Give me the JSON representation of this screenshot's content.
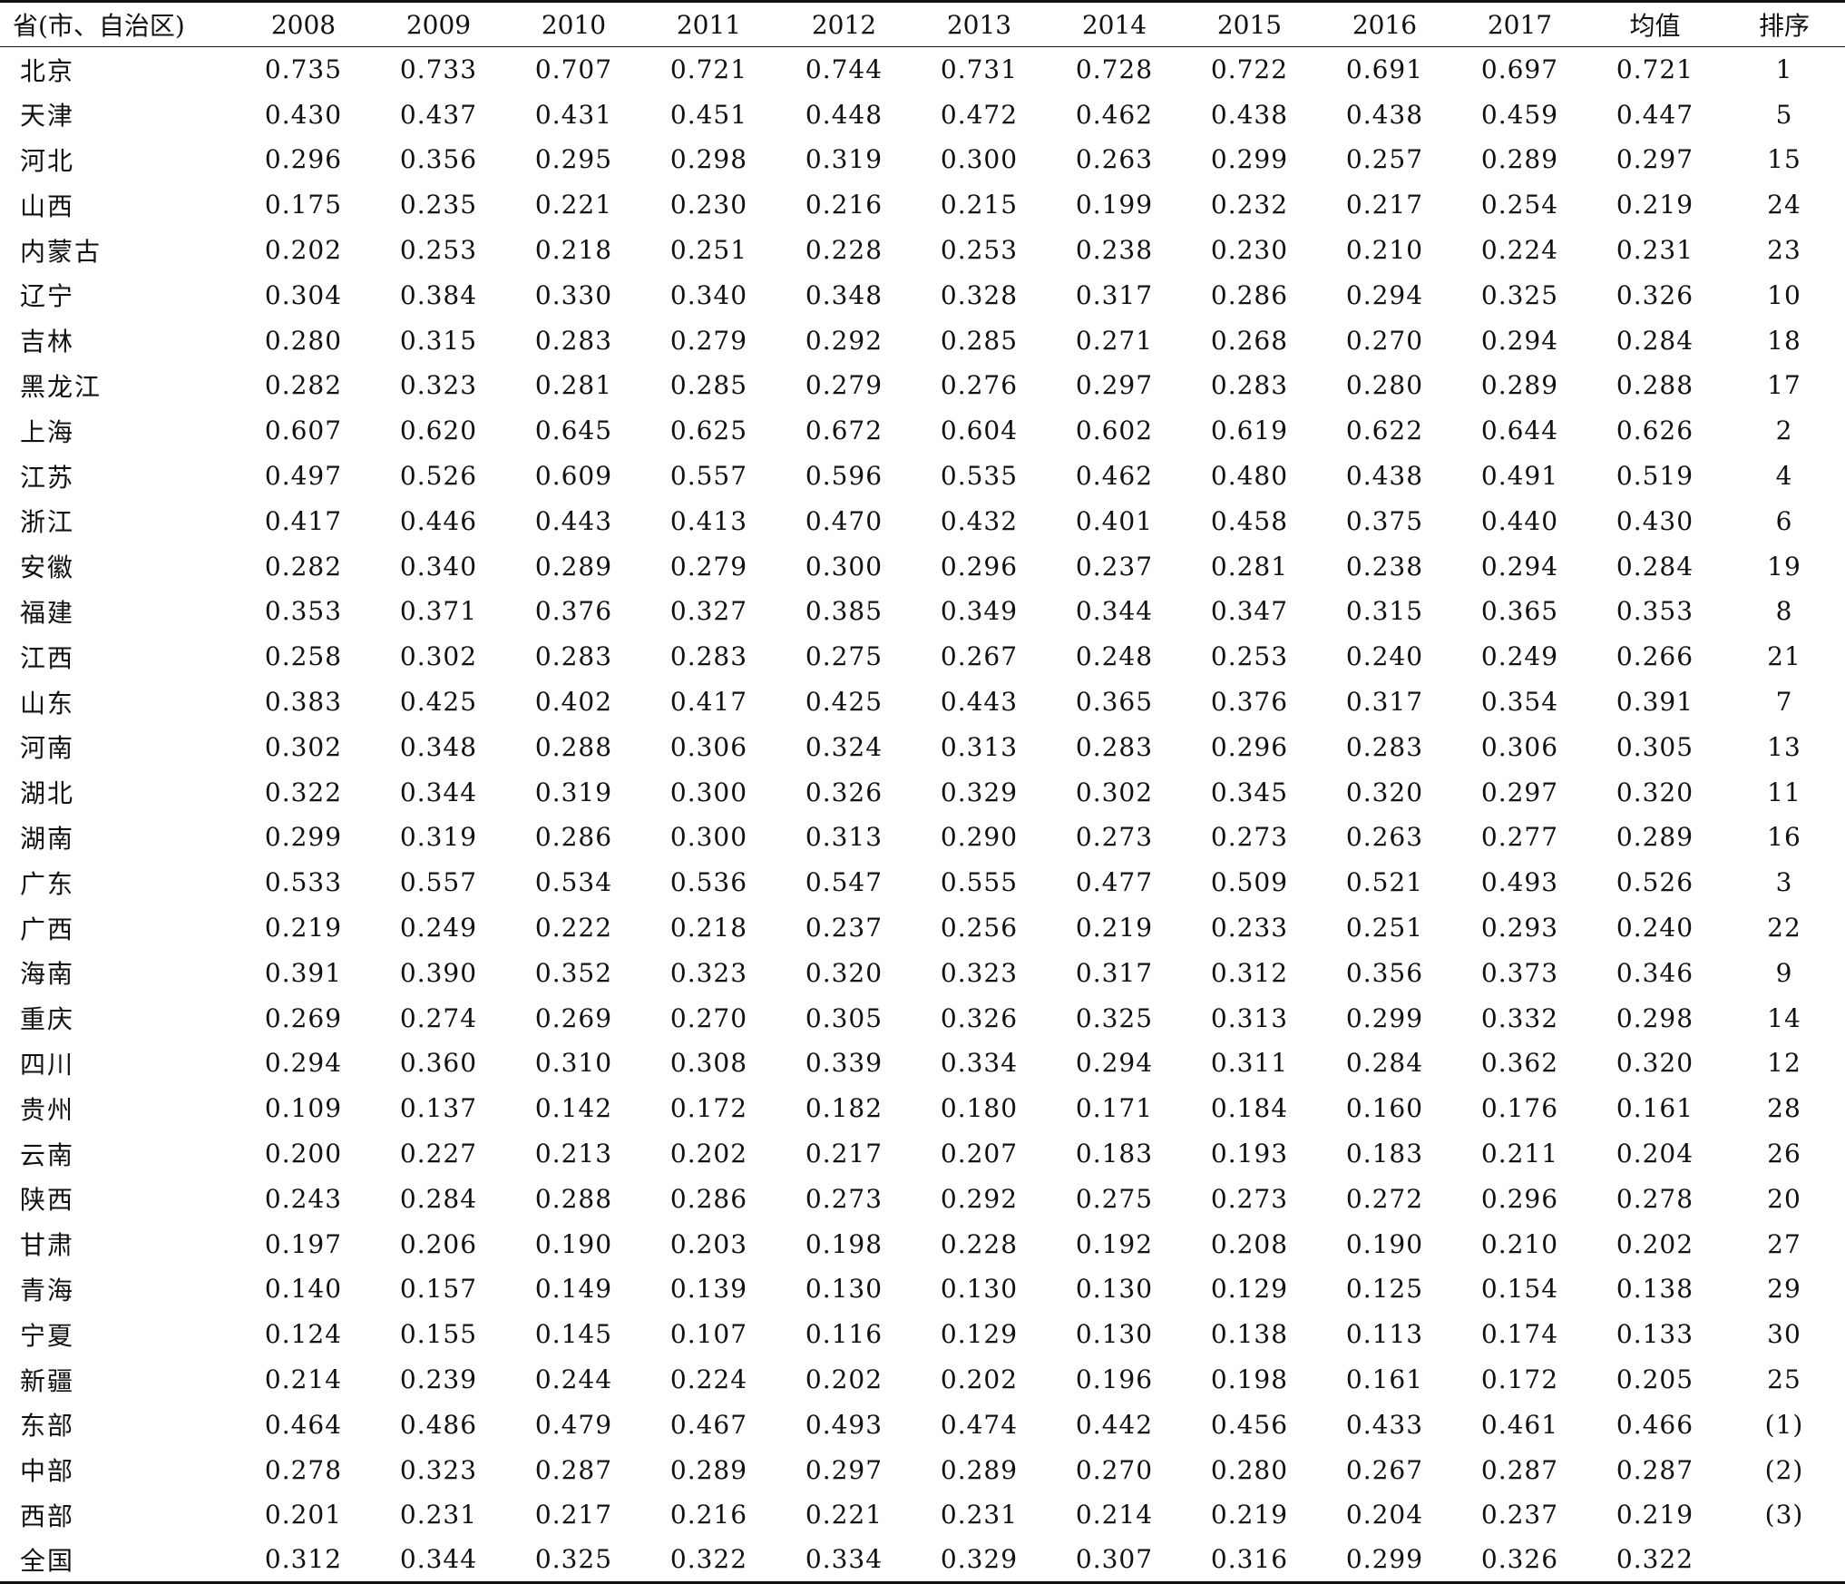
{
  "table": {
    "headers": [
      "省(市、自治区)",
      "2008",
      "2009",
      "2010",
      "2011",
      "2012",
      "2013",
      "2014",
      "2015",
      "2016",
      "2017",
      "均值",
      "排序"
    ],
    "rows": [
      [
        "北京",
        "0.735",
        "0.733",
        "0.707",
        "0.721",
        "0.744",
        "0.731",
        "0.728",
        "0.722",
        "0.691",
        "0.697",
        "0.721",
        "1"
      ],
      [
        "天津",
        "0.430",
        "0.437",
        "0.431",
        "0.451",
        "0.448",
        "0.472",
        "0.462",
        "0.438",
        "0.438",
        "0.459",
        "0.447",
        "5"
      ],
      [
        "河北",
        "0.296",
        "0.356",
        "0.295",
        "0.298",
        "0.319",
        "0.300",
        "0.263",
        "0.299",
        "0.257",
        "0.289",
        "0.297",
        "15"
      ],
      [
        "山西",
        "0.175",
        "0.235",
        "0.221",
        "0.230",
        "0.216",
        "0.215",
        "0.199",
        "0.232",
        "0.217",
        "0.254",
        "0.219",
        "24"
      ],
      [
        "内蒙古",
        "0.202",
        "0.253",
        "0.218",
        "0.251",
        "0.228",
        "0.253",
        "0.238",
        "0.230",
        "0.210",
        "0.224",
        "0.231",
        "23"
      ],
      [
        "辽宁",
        "0.304",
        "0.384",
        "0.330",
        "0.340",
        "0.348",
        "0.328",
        "0.317",
        "0.286",
        "0.294",
        "0.325",
        "0.326",
        "10"
      ],
      [
        "吉林",
        "0.280",
        "0.315",
        "0.283",
        "0.279",
        "0.292",
        "0.285",
        "0.271",
        "0.268",
        "0.270",
        "0.294",
        "0.284",
        "18"
      ],
      [
        "黑龙江",
        "0.282",
        "0.323",
        "0.281",
        "0.285",
        "0.279",
        "0.276",
        "0.297",
        "0.283",
        "0.280",
        "0.289",
        "0.288",
        "17"
      ],
      [
        "上海",
        "0.607",
        "0.620",
        "0.645",
        "0.625",
        "0.672",
        "0.604",
        "0.602",
        "0.619",
        "0.622",
        "0.644",
        "0.626",
        "2"
      ],
      [
        "江苏",
        "0.497",
        "0.526",
        "0.609",
        "0.557",
        "0.596",
        "0.535",
        "0.462",
        "0.480",
        "0.438",
        "0.491",
        "0.519",
        "4"
      ],
      [
        "浙江",
        "0.417",
        "0.446",
        "0.443",
        "0.413",
        "0.470",
        "0.432",
        "0.401",
        "0.458",
        "0.375",
        "0.440",
        "0.430",
        "6"
      ],
      [
        "安徽",
        "0.282",
        "0.340",
        "0.289",
        "0.279",
        "0.300",
        "0.296",
        "0.237",
        "0.281",
        "0.238",
        "0.294",
        "0.284",
        "19"
      ],
      [
        "福建",
        "0.353",
        "0.371",
        "0.376",
        "0.327",
        "0.385",
        "0.349",
        "0.344",
        "0.347",
        "0.315",
        "0.365",
        "0.353",
        "8"
      ],
      [
        "江西",
        "0.258",
        "0.302",
        "0.283",
        "0.283",
        "0.275",
        "0.267",
        "0.248",
        "0.253",
        "0.240",
        "0.249",
        "0.266",
        "21"
      ],
      [
        "山东",
        "0.383",
        "0.425",
        "0.402",
        "0.417",
        "0.425",
        "0.443",
        "0.365",
        "0.376",
        "0.317",
        "0.354",
        "0.391",
        "7"
      ],
      [
        "河南",
        "0.302",
        "0.348",
        "0.288",
        "0.306",
        "0.324",
        "0.313",
        "0.283",
        "0.296",
        "0.283",
        "0.306",
        "0.305",
        "13"
      ],
      [
        "湖北",
        "0.322",
        "0.344",
        "0.319",
        "0.300",
        "0.326",
        "0.329",
        "0.302",
        "0.345",
        "0.320",
        "0.297",
        "0.320",
        "11"
      ],
      [
        "湖南",
        "0.299",
        "0.319",
        "0.286",
        "0.300",
        "0.313",
        "0.290",
        "0.273",
        "0.273",
        "0.263",
        "0.277",
        "0.289",
        "16"
      ],
      [
        "广东",
        "0.533",
        "0.557",
        "0.534",
        "0.536",
        "0.547",
        "0.555",
        "0.477",
        "0.509",
        "0.521",
        "0.493",
        "0.526",
        "3"
      ],
      [
        "广西",
        "0.219",
        "0.249",
        "0.222",
        "0.218",
        "0.237",
        "0.256",
        "0.219",
        "0.233",
        "0.251",
        "0.293",
        "0.240",
        "22"
      ],
      [
        "海南",
        "0.391",
        "0.390",
        "0.352",
        "0.323",
        "0.320",
        "0.323",
        "0.317",
        "0.312",
        "0.356",
        "0.373",
        "0.346",
        "9"
      ],
      [
        "重庆",
        "0.269",
        "0.274",
        "0.269",
        "0.270",
        "0.305",
        "0.326",
        "0.325",
        "0.313",
        "0.299",
        "0.332",
        "0.298",
        "14"
      ],
      [
        "四川",
        "0.294",
        "0.360",
        "0.310",
        "0.308",
        "0.339",
        "0.334",
        "0.294",
        "0.311",
        "0.284",
        "0.362",
        "0.320",
        "12"
      ],
      [
        "贵州",
        "0.109",
        "0.137",
        "0.142",
        "0.172",
        "0.182",
        "0.180",
        "0.171",
        "0.184",
        "0.160",
        "0.176",
        "0.161",
        "28"
      ],
      [
        "云南",
        "0.200",
        "0.227",
        "0.213",
        "0.202",
        "0.217",
        "0.207",
        "0.183",
        "0.193",
        "0.183",
        "0.211",
        "0.204",
        "26"
      ],
      [
        "陕西",
        "0.243",
        "0.284",
        "0.288",
        "0.286",
        "0.273",
        "0.292",
        "0.275",
        "0.273",
        "0.272",
        "0.296",
        "0.278",
        "20"
      ],
      [
        "甘肃",
        "0.197",
        "0.206",
        "0.190",
        "0.203",
        "0.198",
        "0.228",
        "0.192",
        "0.208",
        "0.190",
        "0.210",
        "0.202",
        "27"
      ],
      [
        "青海",
        "0.140",
        "0.157",
        "0.149",
        "0.139",
        "0.130",
        "0.130",
        "0.130",
        "0.129",
        "0.125",
        "0.154",
        "0.138",
        "29"
      ],
      [
        "宁夏",
        "0.124",
        "0.155",
        "0.145",
        "0.107",
        "0.116",
        "0.129",
        "0.130",
        "0.138",
        "0.113",
        "0.174",
        "0.133",
        "30"
      ],
      [
        "新疆",
        "0.214",
        "0.239",
        "0.244",
        "0.224",
        "0.202",
        "0.202",
        "0.196",
        "0.198",
        "0.161",
        "0.172",
        "0.205",
        "25"
      ],
      [
        "东部",
        "0.464",
        "0.486",
        "0.479",
        "0.467",
        "0.493",
        "0.474",
        "0.442",
        "0.456",
        "0.433",
        "0.461",
        "0.466",
        "(1)"
      ],
      [
        "中部",
        "0.278",
        "0.323",
        "0.287",
        "0.289",
        "0.297",
        "0.289",
        "0.270",
        "0.280",
        "0.267",
        "0.287",
        "0.287",
        "(2)"
      ],
      [
        "西部",
        "0.201",
        "0.231",
        "0.217",
        "0.216",
        "0.221",
        "0.231",
        "0.214",
        "0.219",
        "0.204",
        "0.237",
        "0.219",
        "(3)"
      ],
      [
        "全国",
        "0.312",
        "0.344",
        "0.325",
        "0.322",
        "0.334",
        "0.329",
        "0.307",
        "0.316",
        "0.299",
        "0.326",
        "0.322",
        ""
      ]
    ]
  }
}
